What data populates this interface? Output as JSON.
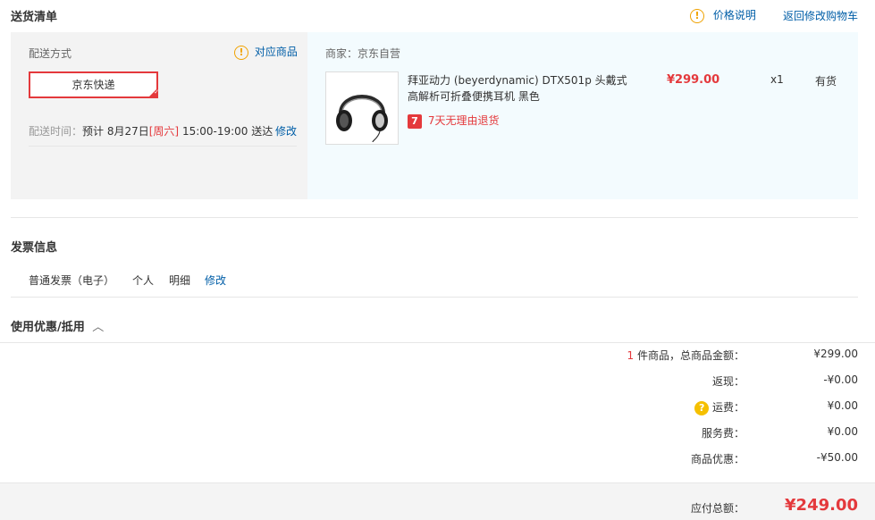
{
  "delivery": {
    "section_title": "送货清单",
    "price_note_label": "价格说明",
    "back_to_cart_label": "返回修改购物车",
    "method_label": "配送方式",
    "corresponding_items_label": "对应商品",
    "shipping_option": "京东快递",
    "time_label": "配送时间：",
    "time_value_prefix": "预计 8月27日",
    "time_weekday": "[周六]",
    "time_value_suffix": " 15:00-19:00 送达",
    "modify_label": "修改"
  },
  "merchant": {
    "label": "商家：",
    "name": "京东自营"
  },
  "product": {
    "title": "拜亚动力 (beyerdynamic) DTX501p 头戴式高解析可折叠便携耳机 黑色",
    "price": "¥299.00",
    "quantity": "x1",
    "stock": "有货",
    "return_badge": "7",
    "return_policy": "7天无理由退货"
  },
  "invoice": {
    "section_title": "发票信息",
    "type": "普通发票（电子）",
    "title_type": "个人",
    "content": "明细",
    "modify_label": "修改"
  },
  "coupon": {
    "section_title": "使用优惠/抵用"
  },
  "summary": {
    "count": "1",
    "count_label": " 件商品，总商品金额：",
    "subtotal": "¥299.00",
    "cashback_label": "返现：",
    "cashback": "-¥0.00",
    "shipping_label": "运费：",
    "shipping": "¥0.00",
    "service_label": "服务费：",
    "service": "¥0.00",
    "discount_label": "商品优惠：",
    "discount": "-¥50.00",
    "total_label": "应付总额：",
    "total": "¥249.00"
  }
}
